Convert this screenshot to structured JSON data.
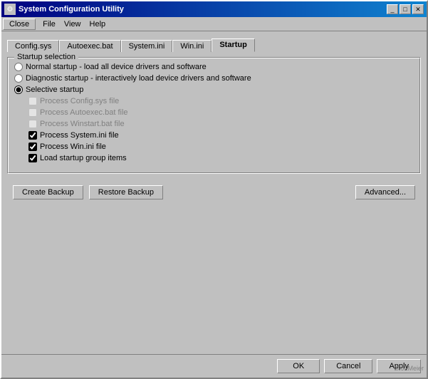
{
  "window": {
    "title": "System Configuration Utility",
    "title_icon": "⚙",
    "buttons": {
      "minimize": "_",
      "maximize": "□",
      "close": "✕"
    }
  },
  "menubar": {
    "items": [
      "File",
      "View",
      "Help"
    ],
    "close_btn": "Close"
  },
  "tabs": [
    {
      "label": "Config.sys",
      "active": false
    },
    {
      "label": "Autoexec.bat",
      "active": false
    },
    {
      "label": "System.ini",
      "active": false
    },
    {
      "label": "Win.ini",
      "active": false
    },
    {
      "label": "Startup",
      "active": true
    }
  ],
  "startup_selection": {
    "group_label": "Startup selection",
    "radios": [
      {
        "id": "r1",
        "label": "Normal startup - load all device drivers and software",
        "checked": false
      },
      {
        "id": "r2",
        "label": "Diagnostic startup - interactively load device drivers and software",
        "checked": false
      },
      {
        "id": "r3",
        "label": "Selective startup",
        "checked": true
      }
    ],
    "checkboxes": [
      {
        "id": "c1",
        "label": "Process Config.sys file",
        "checked": false,
        "enabled": false
      },
      {
        "id": "c2",
        "label": "Process Autoexec.bat file",
        "checked": false,
        "enabled": false
      },
      {
        "id": "c3",
        "label": "Process Winstart.bat file",
        "checked": false,
        "enabled": false
      },
      {
        "id": "c4",
        "label": "Process System.ini file",
        "checked": true,
        "enabled": true
      },
      {
        "id": "c5",
        "label": "Process Win.ini file",
        "checked": true,
        "enabled": true
      },
      {
        "id": "c6",
        "label": "Load startup group items",
        "checked": true,
        "enabled": true
      }
    ]
  },
  "buttons": {
    "create_backup": "Create Backup",
    "restore_backup": "Restore Backup",
    "advanced": "Advanced..."
  },
  "footer": {
    "ok": "OK",
    "cancel": "Cancel",
    "apply": "Apply"
  },
  "watermark": "© JLMeier"
}
